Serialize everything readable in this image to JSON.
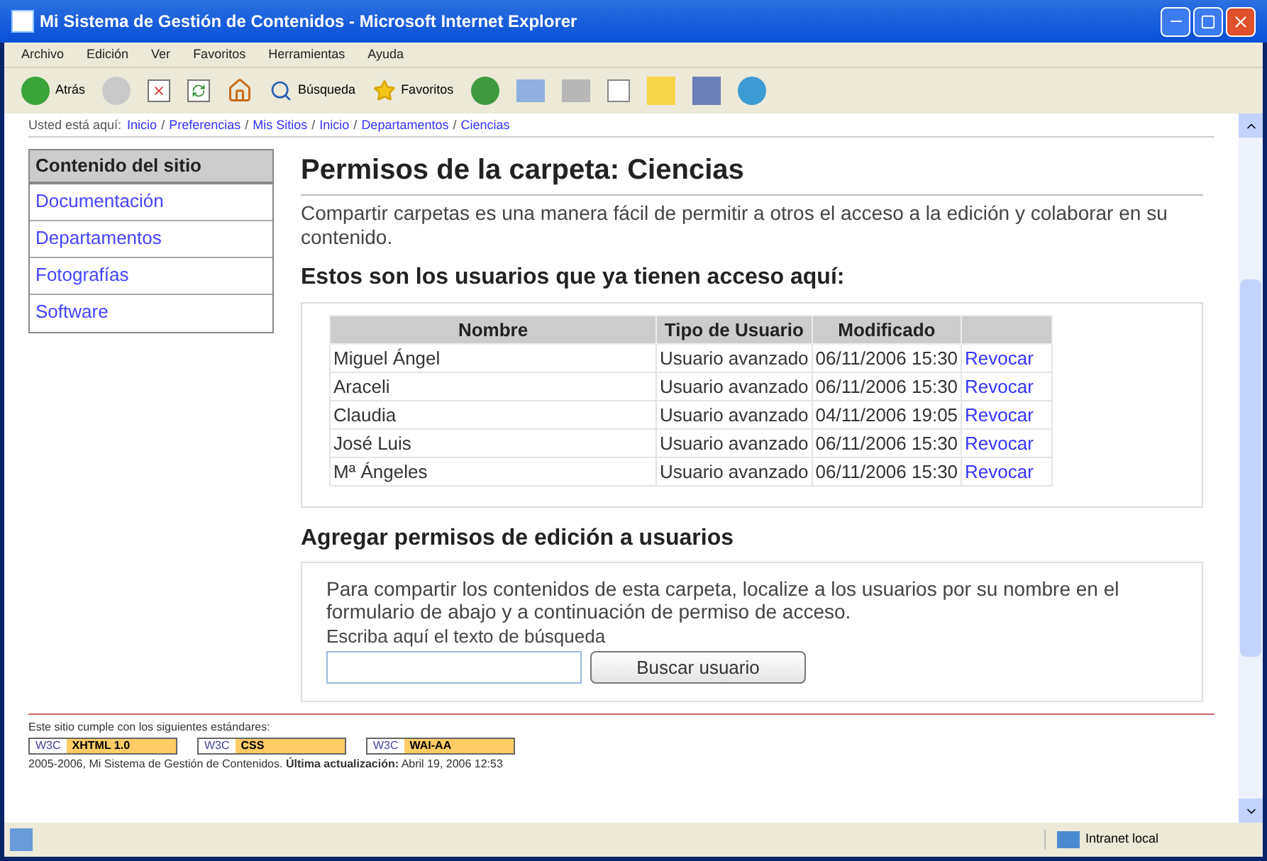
{
  "window": {
    "title": "Mi Sistema de Gestión de Contenidos - Microsoft Internet Explorer"
  },
  "menu": [
    "Archivo",
    "Edición",
    "Ver",
    "Favoritos",
    "Herramientas",
    "Ayuda"
  ],
  "toolbar": {
    "back": "Atrás",
    "search": "Búsqueda",
    "favorites": "Favoritos"
  },
  "breadcrumb": {
    "label": "Usted está aquí:",
    "separator": "/",
    "links": [
      "Inicio",
      "Preferencias",
      "Mis Sitios",
      "Inicio",
      "Departamentos",
      "Ciencias"
    ]
  },
  "sidebar": {
    "title": "Contenido del sitio",
    "items": [
      "Documentación",
      "Departamentos",
      "Fotografías",
      "Software"
    ]
  },
  "page": {
    "title": "Permisos de la carpeta: Ciencias",
    "intro": "Compartir carpetas es una manera fácil de permitir a otros el acceso a la edición y colaborar en su contenido.",
    "users_heading": "Estos son los usuarios que ya tienen acceso aquí:"
  },
  "table": {
    "columns": [
      "Nombre",
      "Tipo de Usuario",
      "Modificado"
    ],
    "rows": [
      {
        "name": "Miguel Ángel",
        "type": "Usuario avanzado",
        "modified": "06/11/2006 15:30",
        "action": "Revocar"
      },
      {
        "name": "Araceli",
        "type": "Usuario avanzado",
        "modified": "06/11/2006 15:30",
        "action": "Revocar"
      },
      {
        "name": "Claudia",
        "type": "Usuario avanzado",
        "modified": "04/11/2006 19:05",
        "action": "Revocar"
      },
      {
        "name": "José Luis",
        "type": "Usuario avanzado",
        "modified": "06/11/2006 15:30",
        "action": "Revocar"
      },
      {
        "name": "Mª Ángeles",
        "type": "Usuario avanzado",
        "modified": "06/11/2006 15:30",
        "action": "Revocar"
      }
    ]
  },
  "add": {
    "heading": "Agregar permisos de edición a usuarios",
    "text": "Para compartir los contenidos de esta carpeta, localize a los usuarios por su nombre en el formulario de abajo y a continuación de permiso de acceso.",
    "search_label": "Escriba aquí el texto de búsqueda",
    "button": "Buscar usuario"
  },
  "footer": {
    "standards_text": "Este sitio cumple con los siguientes estándares:",
    "badges": [
      {
        "org": "W3C",
        "name": "XHTML 1.0"
      },
      {
        "org": "W3C",
        "name": "CSS"
      },
      {
        "org": "W3C",
        "name": "WAI-AA"
      }
    ],
    "copyright": "2005-2006, Mi Sistema de Gestión de Contenidos.",
    "updated_label": "Última actualización:",
    "updated": "Abril 19, 2006 12:53"
  },
  "status_bar": {
    "zone": "Intranet local"
  }
}
